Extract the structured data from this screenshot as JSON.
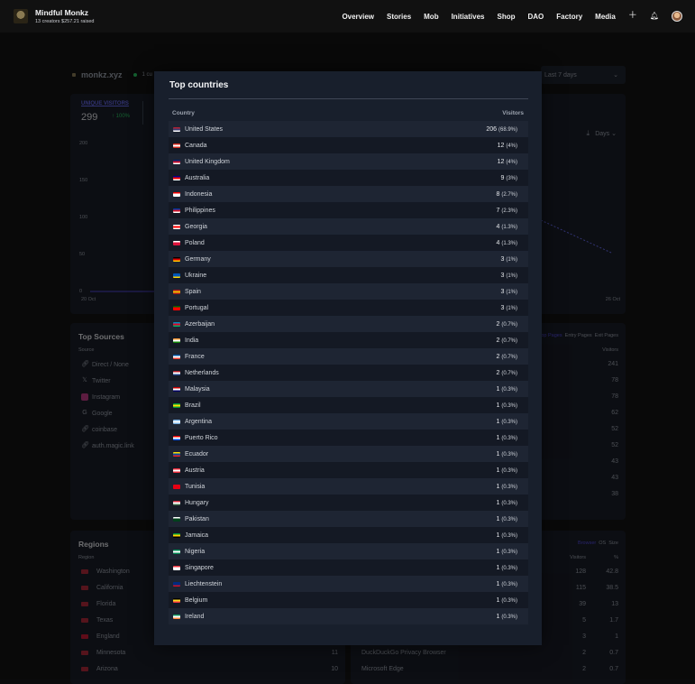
{
  "header": {
    "brand_title": "Mindful Monkz",
    "brand_sub": "13 creators  $257.21 raised",
    "nav": [
      "Overview",
      "Stories",
      "Mob",
      "Initiatives",
      "Shop",
      "DAO",
      "Factory",
      "Media"
    ],
    "icons": [
      "plus-icon",
      "bell-icon",
      "avatar"
    ]
  },
  "background": {
    "site_name": "monkz.xyz",
    "live_text": "1 cu",
    "date_range": "Last 7 days",
    "unique_visitors_label": "Unique visitors",
    "unique_visitors_value": "299",
    "unique_visitors_change": "↑ 100%",
    "interval": "Days",
    "y_ticks": [
      "200",
      "150",
      "100",
      "50",
      "0"
    ],
    "x_start": "20 Oct",
    "x_end": "26 Oct",
    "top_sources": {
      "title": "Top Sources",
      "col": "Source",
      "items": [
        "Direct / None",
        "Twitter",
        "Instagram",
        "Google",
        "coinbase",
        "auth.magic.link"
      ]
    },
    "pages": {
      "tabs": [
        "Top Pages",
        "Entry Pages",
        "Exit Pages"
      ],
      "col": "Visitors",
      "values": [
        "241",
        "78",
        "78",
        "62",
        "52",
        "52",
        "43",
        "43",
        "38"
      ]
    },
    "regions": {
      "title": "Regions",
      "col": "Region",
      "items": [
        "Washington",
        "California",
        "Florida",
        "Texas",
        "England",
        "Minnesota",
        "Arizona"
      ],
      "values": [
        "",
        "",
        "",
        "",
        "",
        "11",
        "10"
      ]
    },
    "browsers": {
      "tabs": [
        "Browser",
        "OS",
        "Size"
      ],
      "cols": [
        "Visitors",
        "%"
      ],
      "rows": [
        {
          "name": "",
          "visitors": "128",
          "pct": "42.8"
        },
        {
          "name": "",
          "visitors": "115",
          "pct": "38.5"
        },
        {
          "name": "",
          "visitors": "39",
          "pct": "13"
        },
        {
          "name": "",
          "visitors": "5",
          "pct": "1.7"
        },
        {
          "name": "",
          "visitors": "3",
          "pct": "1"
        },
        {
          "name": "DuckDuckGo Privacy Browser",
          "visitors": "2",
          "pct": "0.7"
        },
        {
          "name": "Microsoft Edge",
          "visitors": "2",
          "pct": "0.7"
        }
      ]
    }
  },
  "modal": {
    "title": "Top countries",
    "col_country": "Country",
    "col_visitors": "Visitors",
    "rows": [
      {
        "country": "United States",
        "count": "206",
        "pct": "(68.9%)",
        "flag": [
          "#b22234",
          "#3c3b6e",
          "#ffffff"
        ]
      },
      {
        "country": "Canada",
        "count": "12",
        "pct": "(4%)",
        "flag": [
          "#d52b1e",
          "#ffffff",
          "#d52b1e"
        ]
      },
      {
        "country": "United Kingdom",
        "count": "12",
        "pct": "(4%)",
        "flag": [
          "#012169",
          "#c8102e",
          "#ffffff"
        ]
      },
      {
        "country": "Australia",
        "count": "9",
        "pct": "(3%)",
        "flag": [
          "#00008b",
          "#ff0000",
          "#ffffff"
        ]
      },
      {
        "country": "Indonesia",
        "count": "8",
        "pct": "(2.7%)",
        "flag": [
          "#ff0000",
          "#ffffff",
          "#ffffff"
        ]
      },
      {
        "country": "Philippines",
        "count": "7",
        "pct": "(2.3%)",
        "flag": [
          "#0038a8",
          "#ce1126",
          "#ffffff"
        ]
      },
      {
        "country": "Georgia",
        "count": "4",
        "pct": "(1.3%)",
        "flag": [
          "#ffffff",
          "#ff0000",
          "#ffffff"
        ]
      },
      {
        "country": "Poland",
        "count": "4",
        "pct": "(1.3%)",
        "flag": [
          "#ffffff",
          "#dc143c",
          "#dc143c"
        ]
      },
      {
        "country": "Germany",
        "count": "3",
        "pct": "(1%)",
        "flag": [
          "#000000",
          "#dd0000",
          "#ffce00"
        ]
      },
      {
        "country": "Ukraine",
        "count": "3",
        "pct": "(1%)",
        "flag": [
          "#0057b7",
          "#0057b7",
          "#ffd700"
        ]
      },
      {
        "country": "Spain",
        "count": "3",
        "pct": "(1%)",
        "flag": [
          "#aa151b",
          "#f1bf00",
          "#aa151b"
        ]
      },
      {
        "country": "Portugal",
        "count": "3",
        "pct": "(1%)",
        "flag": [
          "#006600",
          "#ff0000",
          "#ff0000"
        ]
      },
      {
        "country": "Azerbaijan",
        "count": "2",
        "pct": "(0.7%)",
        "flag": [
          "#0092bc",
          "#e4002b",
          "#00af66"
        ]
      },
      {
        "country": "India",
        "count": "2",
        "pct": "(0.7%)",
        "flag": [
          "#ff9933",
          "#ffffff",
          "#138808"
        ]
      },
      {
        "country": "France",
        "count": "2",
        "pct": "(0.7%)",
        "flag": [
          "#0055a4",
          "#ffffff",
          "#ef4135"
        ]
      },
      {
        "country": "Netherlands",
        "count": "2",
        "pct": "(0.7%)",
        "flag": [
          "#ae1c28",
          "#ffffff",
          "#21468b"
        ]
      },
      {
        "country": "Malaysia",
        "count": "1",
        "pct": "(0.3%)",
        "flag": [
          "#cc0001",
          "#ffffff",
          "#010066"
        ]
      },
      {
        "country": "Brazil",
        "count": "1",
        "pct": "(0.3%)",
        "flag": [
          "#009c3b",
          "#ffdf00",
          "#009c3b"
        ]
      },
      {
        "country": "Argentina",
        "count": "1",
        "pct": "(0.3%)",
        "flag": [
          "#74acdf",
          "#ffffff",
          "#74acdf"
        ]
      },
      {
        "country": "Puerto Rico",
        "count": "1",
        "pct": "(0.3%)",
        "flag": [
          "#ed0000",
          "#ffffff",
          "#0050f0"
        ]
      },
      {
        "country": "Ecuador",
        "count": "1",
        "pct": "(0.3%)",
        "flag": [
          "#ffdd00",
          "#034ea2",
          "#ed1c24"
        ]
      },
      {
        "country": "Austria",
        "count": "1",
        "pct": "(0.3%)",
        "flag": [
          "#ed2939",
          "#ffffff",
          "#ed2939"
        ]
      },
      {
        "country": "Tunisia",
        "count": "1",
        "pct": "(0.3%)",
        "flag": [
          "#e70013",
          "#e70013",
          "#e70013"
        ]
      },
      {
        "country": "Hungary",
        "count": "1",
        "pct": "(0.3%)",
        "flag": [
          "#cd2a3e",
          "#ffffff",
          "#436f4d"
        ]
      },
      {
        "country": "Pakistan",
        "count": "1",
        "pct": "(0.3%)",
        "flag": [
          "#ffffff",
          "#01411c",
          "#01411c"
        ]
      },
      {
        "country": "Jamaica",
        "count": "1",
        "pct": "(0.3%)",
        "flag": [
          "#009b3a",
          "#fed100",
          "#000000"
        ]
      },
      {
        "country": "Nigeria",
        "count": "1",
        "pct": "(0.3%)",
        "flag": [
          "#008751",
          "#ffffff",
          "#008751"
        ]
      },
      {
        "country": "Singapore",
        "count": "1",
        "pct": "(0.3%)",
        "flag": [
          "#ef3340",
          "#ffffff",
          "#ffffff"
        ]
      },
      {
        "country": "Liechtenstein",
        "count": "1",
        "pct": "(0.3%)",
        "flag": [
          "#002b7f",
          "#002b7f",
          "#ce1126"
        ]
      },
      {
        "country": "Belgium",
        "count": "1",
        "pct": "(0.3%)",
        "flag": [
          "#000000",
          "#fdda24",
          "#ef3340"
        ]
      },
      {
        "country": "Ireland",
        "count": "1",
        "pct": "(0.3%)",
        "flag": [
          "#169b62",
          "#ffffff",
          "#ff883e"
        ]
      }
    ]
  }
}
